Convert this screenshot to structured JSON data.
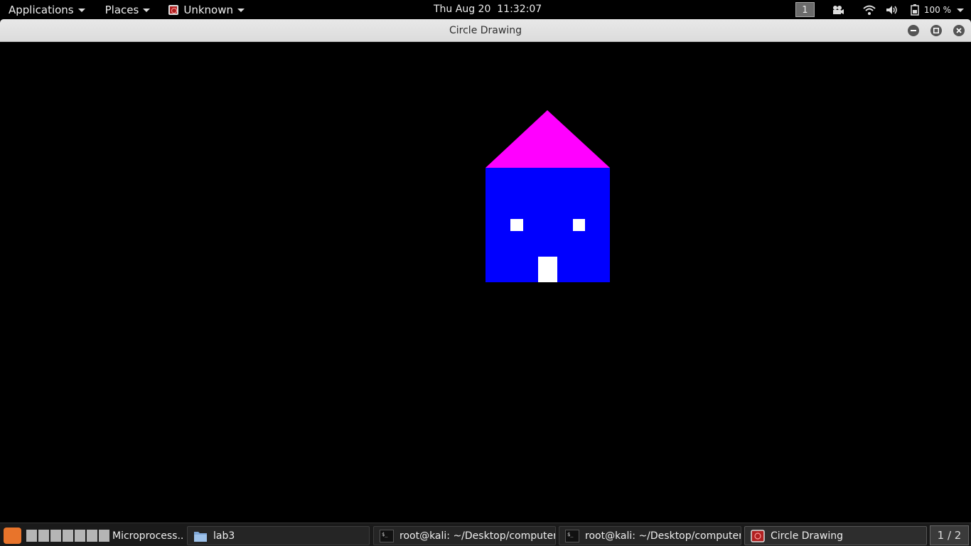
{
  "top_panel": {
    "applications_label": "Applications",
    "places_label": "Places",
    "app_menu_label": "Unknown",
    "clock": "Thu Aug 20  11:32:07",
    "workspace_number": "1",
    "battery_text": "100 %"
  },
  "window": {
    "title": "Circle Drawing"
  },
  "drawing": {
    "background_color": "#000000",
    "roof_color": "#ff00ff",
    "house_color": "#0000ff",
    "window_color": "#ffffff",
    "door_color": "#ffffff"
  },
  "taskbar": {
    "tasks": [
      {
        "label": "Microprocess...",
        "icon": "document-icon"
      },
      {
        "label": "lab3",
        "icon": "folder-icon"
      },
      {
        "label": "root@kali: ~/Desktop/computer-...",
        "icon": "terminal-icon"
      },
      {
        "label": "root@kali: ~/Desktop/computer-...",
        "icon": "terminal-icon"
      },
      {
        "label": "Circle Drawing",
        "icon": "app-icon"
      }
    ],
    "pager_label": "1 / 2"
  }
}
